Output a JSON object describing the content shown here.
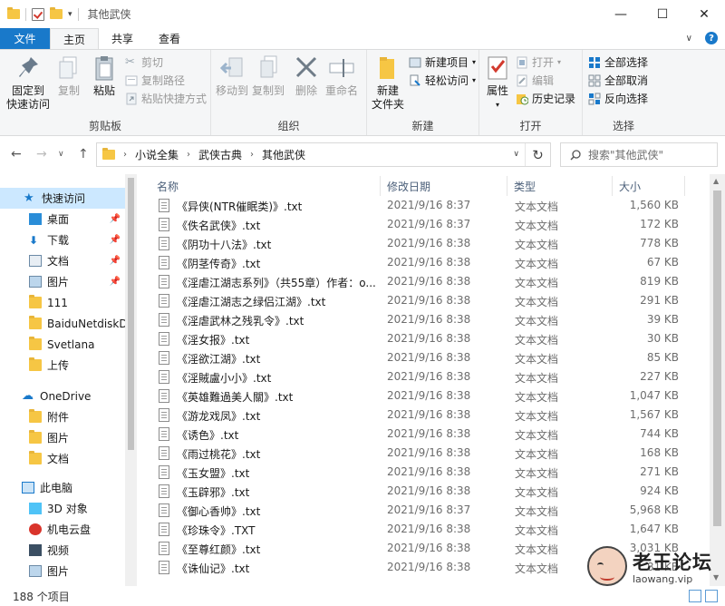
{
  "window": {
    "title": "其他武侠",
    "controls": [
      "—",
      "☐",
      "✕"
    ]
  },
  "ribbon_tabs": {
    "file": "文件",
    "items": [
      "主页",
      "共享",
      "查看"
    ]
  },
  "ribbon": {
    "clipboard": {
      "label": "剪贴板",
      "pin": "固定到\n快速访问",
      "copy": "复制",
      "paste": "粘贴",
      "cut": "剪切",
      "copy_path": "复制路径",
      "paste_shortcut": "粘贴快捷方式"
    },
    "organize": {
      "label": "组织",
      "move_to": "移动到",
      "copy_to": "复制到",
      "delete": "删除",
      "rename": "重命名"
    },
    "new": {
      "label": "新建",
      "new_folder": "新建\n文件夹",
      "new_item": "新建项目",
      "easy_access": "轻松访问"
    },
    "open": {
      "label": "打开",
      "properties": "属性",
      "open": "打开",
      "edit": "编辑",
      "history": "历史记录"
    },
    "select": {
      "label": "选择",
      "select_all": "全部选择",
      "select_none": "全部取消",
      "invert": "反向选择"
    }
  },
  "address": {
    "crumbs": [
      "小说全集",
      "武侠古典",
      "其他武侠"
    ],
    "search_placeholder": "搜索\"其他武侠\""
  },
  "nav": {
    "quick_access": "快速访问",
    "items": [
      "桌面",
      "下载",
      "文档",
      "图片",
      "111",
      "BaiduNetdiskDownload",
      "Svetlana",
      "上传"
    ],
    "onedrive": "OneDrive",
    "onedrive_items": [
      "附件",
      "图片",
      "文档"
    ],
    "this_pc": "此电脑",
    "pc_items": [
      "3D 对象",
      "机电云盘",
      "视频",
      "图片"
    ]
  },
  "columns": {
    "name": "名称",
    "date": "修改日期",
    "type": "类型",
    "size": "大小"
  },
  "files": [
    {
      "name": "《异侠(NTR催眠类)》.txt",
      "date": "2021/9/16 8:37",
      "type": "文本文档",
      "size": "1,560 KB"
    },
    {
      "name": "《佚名武侠》.txt",
      "date": "2021/9/16 8:37",
      "type": "文本文档",
      "size": "172 KB"
    },
    {
      "name": "《阴功十八法》.txt",
      "date": "2021/9/16 8:38",
      "type": "文本文档",
      "size": "778 KB"
    },
    {
      "name": "《阴茎传奇》.txt",
      "date": "2021/9/16 8:38",
      "type": "文本文档",
      "size": "67 KB"
    },
    {
      "name": "《淫虐江湖志系列》（共55章）作者：o...",
      "date": "2021/9/16 8:38",
      "type": "文本文档",
      "size": "819 KB"
    },
    {
      "name": "《淫虐江湖志之绿侣江湖》.txt",
      "date": "2021/9/16 8:38",
      "type": "文本文档",
      "size": "291 KB"
    },
    {
      "name": "《淫虐武林之残乳令》.txt",
      "date": "2021/9/16 8:38",
      "type": "文本文档",
      "size": "39 KB"
    },
    {
      "name": "《淫女报》.txt",
      "date": "2021/9/16 8:38",
      "type": "文本文档",
      "size": "30 KB"
    },
    {
      "name": "《淫欲江湖》.txt",
      "date": "2021/9/16 8:38",
      "type": "文本文档",
      "size": "85 KB"
    },
    {
      "name": "《淫賊盧小小》.txt",
      "date": "2021/9/16 8:38",
      "type": "文本文档",
      "size": "227 KB"
    },
    {
      "name": "《英雄難過美人關》.txt",
      "date": "2021/9/16 8:38",
      "type": "文本文档",
      "size": "1,047 KB"
    },
    {
      "name": "《游龙戏凤》.txt",
      "date": "2021/9/16 8:38",
      "type": "文本文档",
      "size": "1,567 KB"
    },
    {
      "name": "《诱色》.txt",
      "date": "2021/9/16 8:38",
      "type": "文本文档",
      "size": "744 KB"
    },
    {
      "name": "《雨过桃花》.txt",
      "date": "2021/9/16 8:38",
      "type": "文本文档",
      "size": "168 KB"
    },
    {
      "name": "《玉女盟》.txt",
      "date": "2021/9/16 8:38",
      "type": "文本文档",
      "size": "271 KB"
    },
    {
      "name": "《玉辟邪》.txt",
      "date": "2021/9/16 8:38",
      "type": "文本文档",
      "size": "924 KB"
    },
    {
      "name": "《御心香帅》.txt",
      "date": "2021/9/16 8:37",
      "type": "文本文档",
      "size": "5,968 KB"
    },
    {
      "name": "《珍珠令》.TXT",
      "date": "2021/9/16 8:38",
      "type": "文本文档",
      "size": "1,647 KB"
    },
    {
      "name": "《至尊红颜》.txt",
      "date": "2021/9/16 8:38",
      "type": "文本文档",
      "size": "3,031 KB"
    },
    {
      "name": "《诛仙记》.txt",
      "date": "2021/9/16 8:38",
      "type": "文本文档",
      "size": "81 KB"
    }
  ],
  "status": {
    "count": "188 个项目"
  },
  "watermark": {
    "title": "老王论坛",
    "url": "laowang.vip"
  }
}
